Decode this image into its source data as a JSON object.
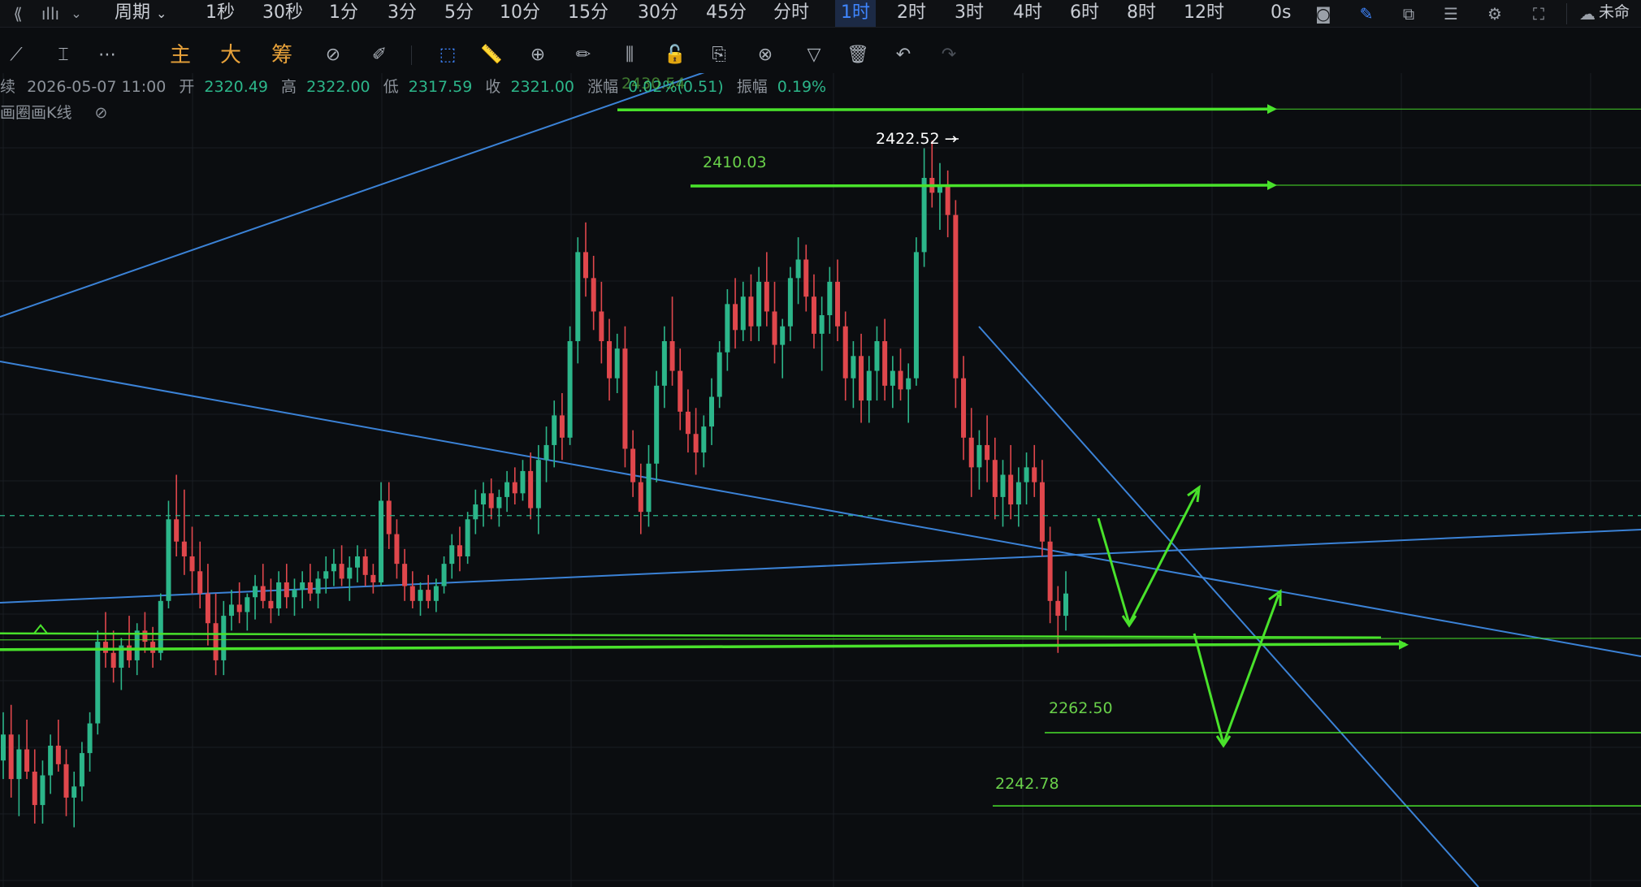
{
  "topbar": {
    "period_menu_label": "周期",
    "periods": [
      "1秒",
      "30秒",
      "1分",
      "3分",
      "5分",
      "10分",
      "15分",
      "30分",
      "45分",
      "分时",
      "1时",
      "2时",
      "3时",
      "4时",
      "6时",
      "8时",
      "12时"
    ],
    "active_period": "1时",
    "countdown": "0s",
    "account_label": "未命"
  },
  "toolbar": {
    "main_label": "主",
    "big_label": "大",
    "chip_label": "筹"
  },
  "ohlc": {
    "prefix": "续",
    "datetime": "2026-05-07 11:00",
    "open_label": "开",
    "open": "2320.49",
    "high_label": "高",
    "high": "2322.00",
    "low_label": "低",
    "low": "2317.59",
    "close_label": "收",
    "close": "2321.00",
    "chg_label": "涨幅",
    "chg": "0.02%(0.51)",
    "amp_label": "振幅",
    "amp": "0.19%"
  },
  "overlay_label": "画圈画K线",
  "price_labels": {
    "top_partial": "2430.54",
    "peak": "2422.52 →",
    "resistance": "2410.03",
    "support1": "2262.50",
    "support2": "2242.78"
  },
  "colors": {
    "up": "#2cb68a",
    "down": "#e0474c",
    "trendline": "#3b82d6",
    "level": "#49e22b",
    "active_tab": "#3f86ff"
  },
  "chart_data": {
    "type": "candlestick",
    "timeframe": "1时",
    "candles": [
      [
        2255,
        2268,
        2250,
        2262
      ],
      [
        2262,
        2270,
        2245,
        2250
      ],
      [
        2250,
        2262,
        2240,
        2258
      ],
      [
        2258,
        2266,
        2250,
        2252
      ],
      [
        2252,
        2258,
        2238,
        2243
      ],
      [
        2243,
        2255,
        2238,
        2251
      ],
      [
        2251,
        2262,
        2246,
        2259
      ],
      [
        2259,
        2266,
        2252,
        2254
      ],
      [
        2254,
        2258,
        2240,
        2245
      ],
      [
        2245,
        2252,
        2237,
        2248
      ],
      [
        2248,
        2260,
        2244,
        2257
      ],
      [
        2257,
        2268,
        2252,
        2265
      ],
      [
        2265,
        2290,
        2262,
        2287
      ],
      [
        2287,
        2295,
        2280,
        2284
      ],
      [
        2284,
        2290,
        2276,
        2280
      ],
      [
        2280,
        2288,
        2274,
        2286
      ],
      [
        2286,
        2294,
        2280,
        2282
      ],
      [
        2282,
        2292,
        2278,
        2290
      ],
      [
        2290,
        2295,
        2284,
        2287
      ],
      [
        2287,
        2291,
        2280,
        2284
      ],
      [
        2284,
        2300,
        2282,
        2298
      ],
      [
        2298,
        2325,
        2296,
        2320
      ],
      [
        2320,
        2332,
        2310,
        2314
      ],
      [
        2314,
        2328,
        2305,
        2310
      ],
      [
        2310,
        2318,
        2300,
        2306
      ],
      [
        2306,
        2314,
        2296,
        2300
      ],
      [
        2300,
        2308,
        2286,
        2292
      ],
      [
        2292,
        2300,
        2278,
        2282
      ],
      [
        2282,
        2298,
        2278,
        2294
      ],
      [
        2294,
        2301,
        2290,
        2297
      ],
      [
        2297,
        2303,
        2292,
        2295
      ],
      [
        2295,
        2300,
        2290,
        2299
      ],
      [
        2299,
        2305,
        2293,
        2302
      ],
      [
        2302,
        2308,
        2296,
        2298
      ],
      [
        2298,
        2304,
        2292,
        2296
      ],
      [
        2296,
        2306,
        2294,
        2303
      ],
      [
        2303,
        2308,
        2296,
        2299
      ],
      [
        2299,
        2304,
        2294,
        2301
      ],
      [
        2301,
        2306,
        2296,
        2303
      ],
      [
        2303,
        2308,
        2298,
        2300
      ],
      [
        2300,
        2306,
        2296,
        2304
      ],
      [
        2304,
        2310,
        2300,
        2306
      ],
      [
        2306,
        2312,
        2302,
        2308
      ],
      [
        2308,
        2313,
        2302,
        2304
      ],
      [
        2304,
        2310,
        2298,
        2307
      ],
      [
        2307,
        2313,
        2303,
        2310
      ],
      [
        2310,
        2312,
        2302,
        2305
      ],
      [
        2305,
        2308,
        2300,
        2303
      ],
      [
        2303,
        2330,
        2302,
        2325
      ],
      [
        2325,
        2330,
        2312,
        2316
      ],
      [
        2316,
        2320,
        2304,
        2308
      ],
      [
        2308,
        2312,
        2298,
        2302
      ],
      [
        2302,
        2306,
        2296,
        2298
      ],
      [
        2298,
        2303,
        2294,
        2301
      ],
      [
        2301,
        2305,
        2296,
        2298
      ],
      [
        2298,
        2304,
        2295,
        2302
      ],
      [
        2302,
        2310,
        2300,
        2308
      ],
      [
        2308,
        2316,
        2304,
        2313
      ],
      [
        2313,
        2318,
        2306,
        2310
      ],
      [
        2310,
        2322,
        2308,
        2320
      ],
      [
        2320,
        2328,
        2316,
        2324
      ],
      [
        2324,
        2330,
        2318,
        2327
      ],
      [
        2327,
        2331,
        2320,
        2323
      ],
      [
        2323,
        2328,
        2318,
        2326
      ],
      [
        2326,
        2333,
        2322,
        2330
      ],
      [
        2330,
        2334,
        2324,
        2327
      ],
      [
        2327,
        2336,
        2325,
        2333
      ],
      [
        2333,
        2338,
        2320,
        2323
      ],
      [
        2323,
        2340,
        2316,
        2336
      ],
      [
        2336,
        2345,
        2330,
        2340
      ],
      [
        2340,
        2352,
        2334,
        2348
      ],
      [
        2348,
        2354,
        2336,
        2342
      ],
      [
        2342,
        2372,
        2340,
        2368
      ],
      [
        2368,
        2396,
        2362,
        2392
      ],
      [
        2392,
        2400,
        2380,
        2385
      ],
      [
        2385,
        2391,
        2371,
        2376
      ],
      [
        2376,
        2384,
        2362,
        2368
      ],
      [
        2368,
        2374,
        2352,
        2358
      ],
      [
        2358,
        2370,
        2354,
        2366
      ],
      [
        2366,
        2372,
        2334,
        2339
      ],
      [
        2339,
        2344,
        2326,
        2330
      ],
      [
        2330,
        2335,
        2316,
        2322
      ],
      [
        2322,
        2340,
        2318,
        2335
      ],
      [
        2335,
        2360,
        2330,
        2356
      ],
      [
        2356,
        2372,
        2350,
        2368
      ],
      [
        2368,
        2380,
        2356,
        2360
      ],
      [
        2360,
        2366,
        2344,
        2349
      ],
      [
        2349,
        2355,
        2338,
        2343
      ],
      [
        2343,
        2350,
        2332,
        2338
      ],
      [
        2338,
        2348,
        2334,
        2345
      ],
      [
        2345,
        2358,
        2340,
        2353
      ],
      [
        2353,
        2368,
        2350,
        2365
      ],
      [
        2365,
        2382,
        2360,
        2378
      ],
      [
        2378,
        2385,
        2366,
        2371
      ],
      [
        2371,
        2384,
        2368,
        2380
      ],
      [
        2380,
        2386,
        2368,
        2372
      ],
      [
        2372,
        2388,
        2368,
        2384
      ],
      [
        2384,
        2392,
        2372,
        2376
      ],
      [
        2376,
        2384,
        2362,
        2367
      ],
      [
        2367,
        2374,
        2358,
        2372
      ],
      [
        2372,
        2388,
        2368,
        2385
      ],
      [
        2385,
        2396,
        2378,
        2390
      ],
      [
        2390,
        2394,
        2376,
        2380
      ],
      [
        2380,
        2386,
        2366,
        2370
      ],
      [
        2370,
        2380,
        2360,
        2375
      ],
      [
        2375,
        2388,
        2370,
        2384
      ],
      [
        2384,
        2390,
        2368,
        2372
      ],
      [
        2372,
        2376,
        2352,
        2358
      ],
      [
        2358,
        2368,
        2350,
        2364
      ],
      [
        2364,
        2370,
        2346,
        2352
      ],
      [
        2352,
        2364,
        2346,
        2360
      ],
      [
        2360,
        2372,
        2352,
        2368
      ],
      [
        2368,
        2374,
        2352,
        2356
      ],
      [
        2356,
        2364,
        2350,
        2360
      ],
      [
        2360,
        2366,
        2352,
        2355
      ],
      [
        2355,
        2362,
        2346,
        2358
      ],
      [
        2358,
        2396,
        2356,
        2392
      ],
      [
        2392,
        2420,
        2388,
        2412
      ],
      [
        2412,
        2422,
        2404,
        2408
      ],
      [
        2408,
        2416,
        2398,
        2410
      ],
      [
        2410,
        2414,
        2396,
        2402
      ],
      [
        2402,
        2406,
        2350,
        2358
      ],
      [
        2358,
        2364,
        2336,
        2342
      ],
      [
        2342,
        2350,
        2326,
        2334
      ],
      [
        2334,
        2344,
        2328,
        2340
      ],
      [
        2340,
        2348,
        2330,
        2336
      ],
      [
        2336,
        2342,
        2320,
        2326
      ],
      [
        2326,
        2336,
        2318,
        2332
      ],
      [
        2332,
        2340,
        2320,
        2324
      ],
      [
        2324,
        2334,
        2318,
        2330
      ],
      [
        2330,
        2338,
        2324,
        2334
      ],
      [
        2334,
        2340,
        2326,
        2330
      ],
      [
        2330,
        2336,
        2310,
        2314
      ],
      [
        2314,
        2318,
        2292,
        2298
      ],
      [
        2298,
        2302,
        2284,
        2294
      ],
      [
        2294,
        2306,
        2290,
        2300
      ]
    ],
    "horizontal_levels": [
      2430.54,
      2410.03,
      2262.5,
      2242.78
    ],
    "marked_high": 2422.52,
    "last_close": 2321.0
  }
}
